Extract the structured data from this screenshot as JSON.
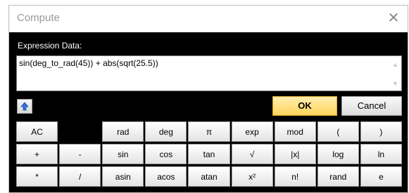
{
  "window": {
    "title": "Compute",
    "close_glyph": "✕"
  },
  "expression": {
    "label": "Expression Data:",
    "value": "sin(deg_to_rad(45)) + abs(sqrt(25.5))"
  },
  "buttons": {
    "ok": "OK",
    "cancel": "Cancel"
  },
  "keypad": [
    [
      "AC",
      "",
      "rad",
      "deg",
      "π",
      "exp",
      "mod",
      "(",
      ")"
    ],
    [
      "+",
      "-",
      "sin",
      "cos",
      "tan",
      "√",
      "|x|",
      "log",
      "ln"
    ],
    [
      "*",
      "/",
      "asin",
      "acos",
      "atan",
      "x²",
      "n!",
      "rand",
      "e"
    ]
  ],
  "icons": {
    "shift": "shift-up-arrow-icon",
    "scroll_up": "chevron-up-icon",
    "scroll_down": "chevron-down-icon"
  },
  "colors": {
    "ok_button": "#ffd35a",
    "shift_arrow": "#3a6fd8",
    "window_body": "#000000"
  }
}
